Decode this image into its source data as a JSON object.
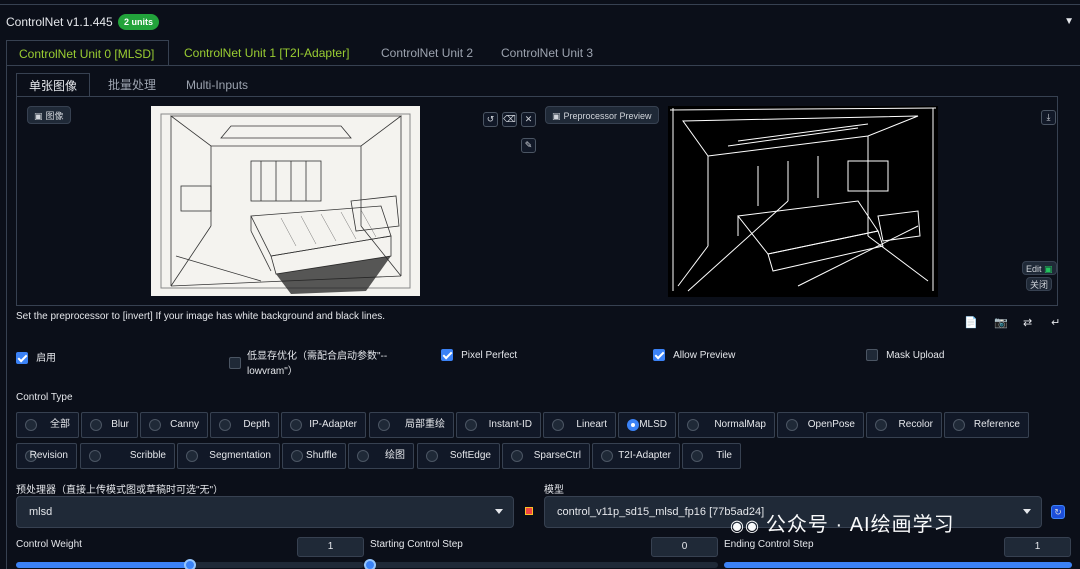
{
  "header": {
    "title": "ControlNet v1.1.445",
    "units_badge": "2 units",
    "collapse_icon": "triangle-down-icon"
  },
  "unit_tabs": [
    {
      "label": "ControlNet Unit 0 [MLSD]",
      "active": true
    },
    {
      "label": "ControlNet Unit 1 [T2I-Adapter]",
      "active": false
    },
    {
      "label": "ControlNet Unit 2",
      "active": false
    },
    {
      "label": "ControlNet Unit 3",
      "active": false
    }
  ],
  "sub_tabs": [
    {
      "label": "单张图像",
      "active": true
    },
    {
      "label": "批量处理",
      "active": false
    },
    {
      "label": "Multi-Inputs",
      "active": false
    }
  ],
  "image_panel": {
    "input_label": "图像",
    "preview_label": "Preprocessor Preview",
    "edit_label": "Edit",
    "close_label": "关闭"
  },
  "hint": "Set the preprocessor to [invert] If your image has white background and black lines.",
  "options": {
    "enable": {
      "label": "启用",
      "checked": true
    },
    "low_vram": {
      "label_line1": "低显存优化（需配合启动参数\"--",
      "label_line2": "lowvram\"）",
      "checked": false
    },
    "pixel_perfect": {
      "label": "Pixel Perfect",
      "checked": true
    },
    "allow_preview": {
      "label": "Allow Preview",
      "checked": true
    },
    "mask_upload": {
      "label": "Mask Upload",
      "checked": false
    }
  },
  "control_type": {
    "label": "Control Type",
    "row1": [
      "全部",
      "Blur",
      "Canny",
      "Depth",
      "IP-Adapter",
      "局部重绘",
      "Instant-ID",
      "Lineart",
      "MLSD",
      "NormalMap",
      "OpenPose",
      "Recolor",
      "Reference"
    ],
    "row2": [
      "Revision",
      "Scribble",
      "Segmentation",
      "Shuffle",
      "绘图",
      "SoftEdge",
      "SparseCtrl",
      "T2I-Adapter",
      "Tile"
    ],
    "selected": "MLSD"
  },
  "preprocessor": {
    "label": "预处理器（直接上传模式图或草稿时可选\"无\"）",
    "value": "mlsd"
  },
  "model": {
    "label": "模型",
    "value": "control_v11p_sd15_mlsd_fp16 [77b5ad24]"
  },
  "sliders": {
    "control_weight": {
      "label": "Control Weight",
      "value": "1",
      "fraction": 0.5
    },
    "start_step": {
      "label": "Starting Control Step",
      "value": "0",
      "fraction": 0.0
    },
    "end_step": {
      "label": "Ending Control Step",
      "value": "1",
      "fraction": 1.0
    }
  },
  "watermark": "公众号 · AI绘画学习",
  "colors": {
    "accent": "#3b82f6",
    "badge": "#22a33b",
    "tab_active": "#9acd32",
    "background": "#0b0f19"
  }
}
